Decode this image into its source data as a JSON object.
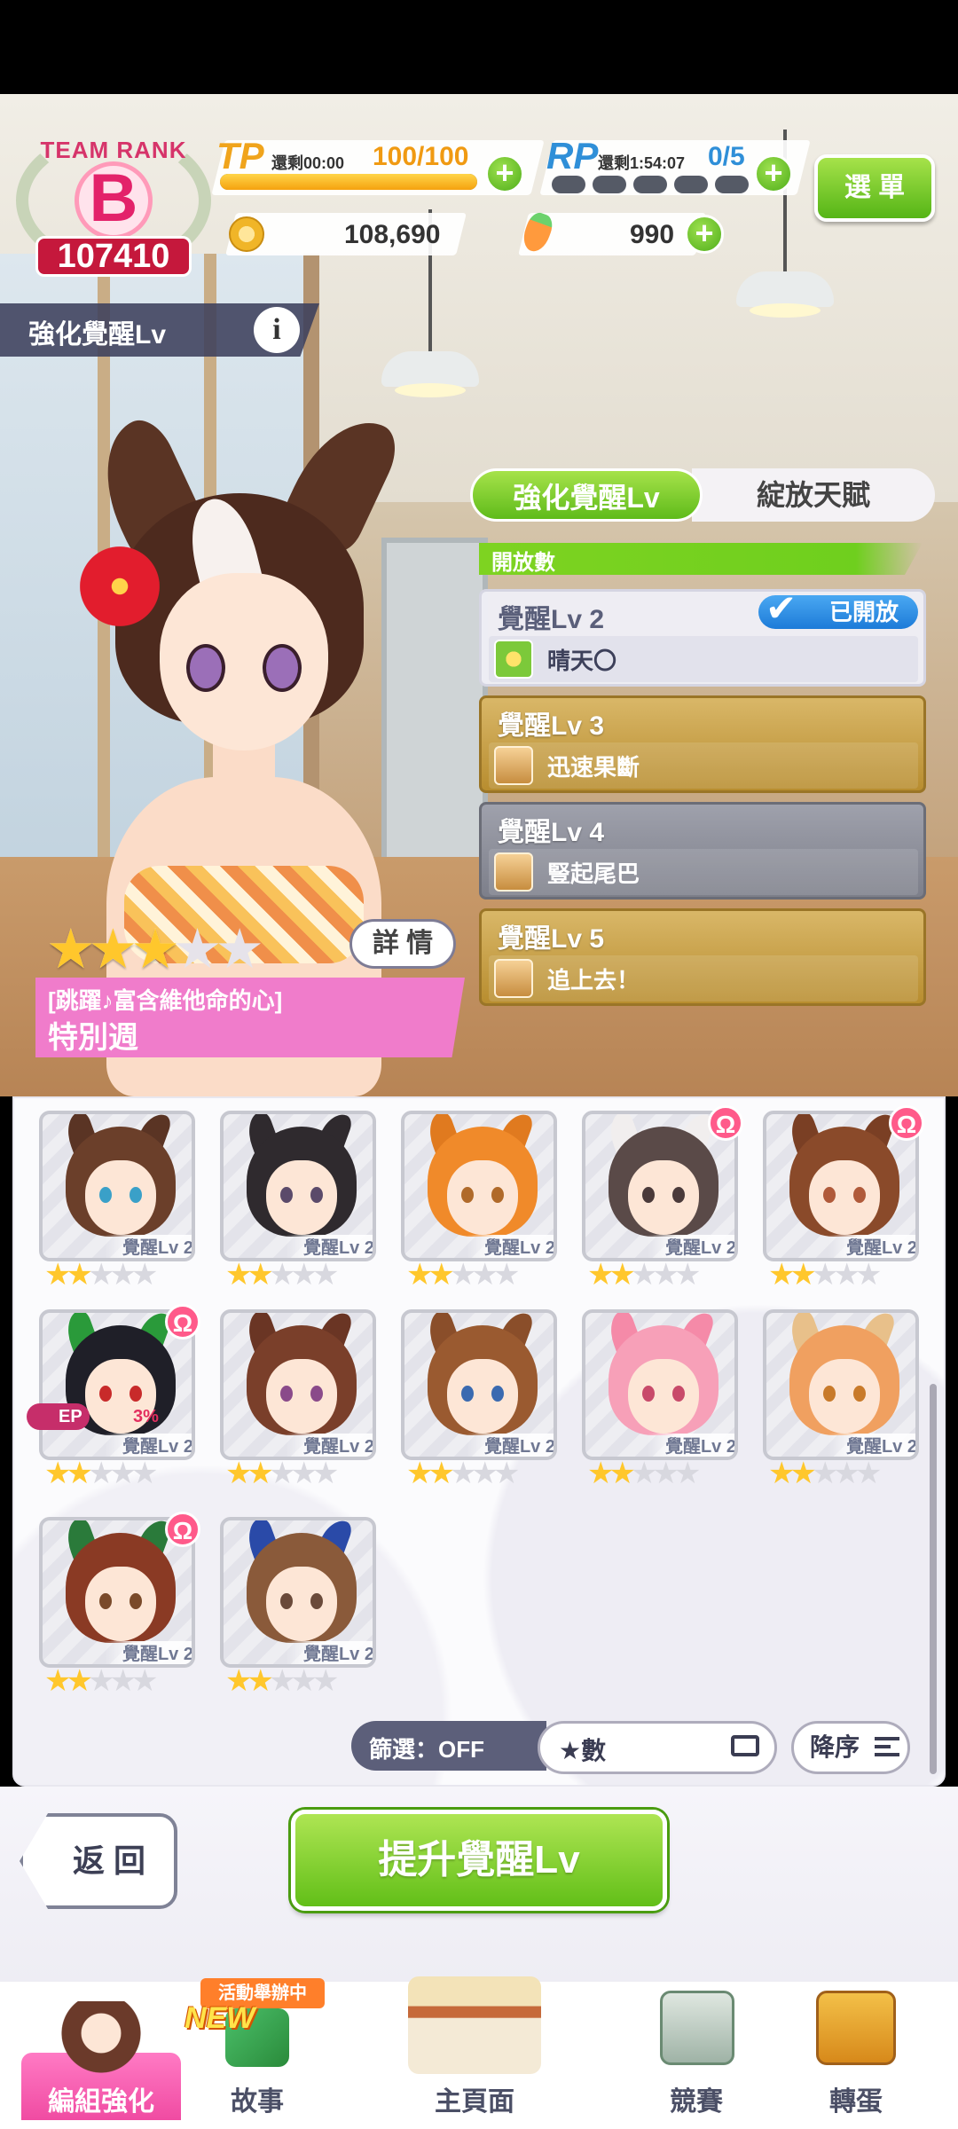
{
  "hud": {
    "team_rank_label": "TEAM RANK",
    "team_rank_letter": "B",
    "team_rank_score": "107410",
    "tp": {
      "label": "TP",
      "timer": "還剩00:00",
      "value": "100/100",
      "fill": 1.0
    },
    "rp": {
      "label": "RP",
      "timer": "還剩1:54:07",
      "value": "0/5",
      "filled": 0
    },
    "coins": "108,690",
    "carrots": "990",
    "menu_label": "選 單",
    "plus": "+"
  },
  "screen": {
    "title": "強化覺醒Lv",
    "info": "i"
  },
  "tabs": {
    "active": "強化覺醒Lv",
    "inactive": "綻放天賦"
  },
  "awakening": {
    "open_count_label": "開放數",
    "opened_label": "已開放",
    "levels": [
      {
        "title": "覺醒Lv 2",
        "skill": "晴天〇",
        "status": "open"
      },
      {
        "title": "覺醒Lv 3",
        "skill": "迅速果斷",
        "status": "gold"
      },
      {
        "title": "覺醒Lv 4",
        "skill": "豎起尾巴",
        "status": "grey"
      },
      {
        "title": "覺醒Lv 5",
        "skill": "追上去！",
        "status": "gold"
      }
    ]
  },
  "card": {
    "stars_on": 3,
    "stars_total": 5,
    "detail_label": "詳 情",
    "subtitle": "[跳躍♪富含維他命的心]",
    "name": "特別週"
  },
  "roster": {
    "lv_label": "覺醒Lv 2",
    "ep_label": "EP",
    "ep_pct": "3%",
    "items": [
      {
        "hair": "#6b3f2a",
        "ear": "#5a3424",
        "eye": "#3aa0c8",
        "stars": 2,
        "badge": false
      },
      {
        "hair": "#2f2a2e",
        "ear": "#2f2a2e",
        "eye": "#5b4a6a",
        "stars": 2,
        "badge": false
      },
      {
        "hair": "#f08a2a",
        "ear": "#e07a1f",
        "eye": "#b06a2a",
        "stars": 2,
        "badge": false
      },
      {
        "hair": "#5a4a48",
        "ear": "#f1eeee",
        "eye": "#4a3a3a",
        "stars": 2,
        "badge": true
      },
      {
        "hair": "#8a4a2a",
        "ear": "#7a3f24",
        "eye": "#b05a3a",
        "stars": 2,
        "badge": true
      },
      {
        "hair": "#1f1f28",
        "ear": "#2a9a3a",
        "eye": "#c82a2a",
        "stars": 2,
        "badge": true
      },
      {
        "hair": "#7a3f2a",
        "ear": "#6a3524",
        "eye": "#8a4a8a",
        "stars": 2,
        "badge": false
      },
      {
        "hair": "#9a5a30",
        "ear": "#8a4e2a",
        "eye": "#3a6ab0",
        "stars": 2,
        "badge": false
      },
      {
        "hair": "#f7a0b8",
        "ear": "#f58aa8",
        "eye": "#c84a6a",
        "stars": 2,
        "badge": false
      },
      {
        "hair": "#f0a060",
        "ear": "#e8c08a",
        "eye": "#c87a2a",
        "stars": 2,
        "badge": false
      },
      {
        "hair": "#8a3a24",
        "ear": "#2a7a3a",
        "eye": "#7a4a2a",
        "stars": 2,
        "badge": true
      },
      {
        "hair": "#8a5a3a",
        "ear": "#2a4aa8",
        "eye": "#6a4a3a",
        "stars": 2,
        "badge": false
      }
    ],
    "filter_label": "篩選：OFF",
    "sort_label": "★數",
    "order_label": "降序"
  },
  "actions": {
    "back_label": "返 回",
    "main_label": "提升覺醒Lv"
  },
  "nav": {
    "event_tag": "活動舉辦中",
    "new_tag": "NEW",
    "items": [
      {
        "label": "編組強化",
        "active": true
      },
      {
        "label": "故事",
        "active": false
      },
      {
        "label": "主頁面",
        "active": false
      },
      {
        "label": "競賽",
        "active": false
      },
      {
        "label": "轉蛋",
        "active": false
      }
    ]
  },
  "colors": {
    "accent_green": "#6fcf1e",
    "rank_pink": "#e3226a",
    "opened_blue": "#1d7bd8",
    "active_nav": "#f04ba2"
  }
}
